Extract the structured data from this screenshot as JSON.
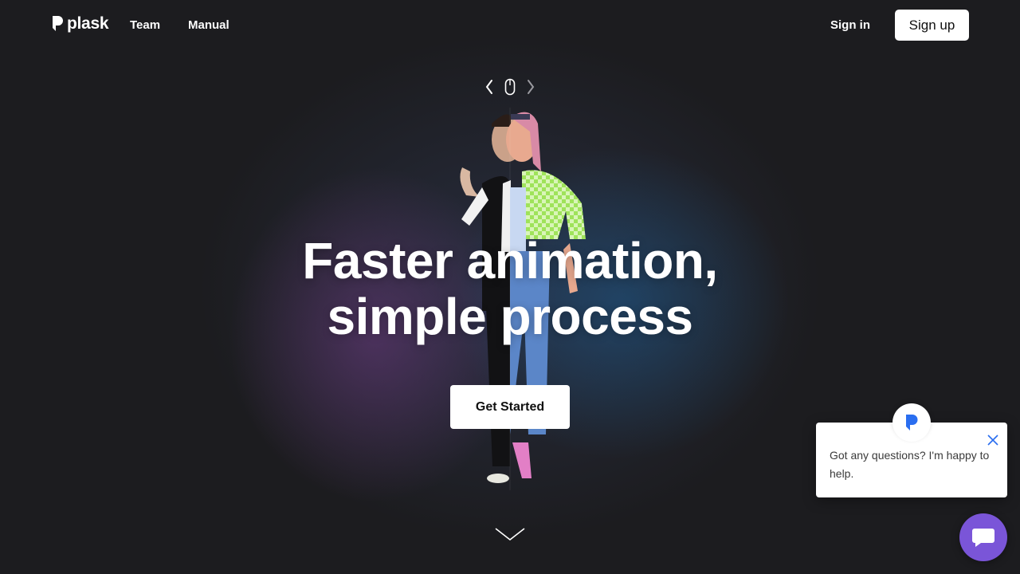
{
  "nav": {
    "logo_text": "plask",
    "links": [
      "Team",
      "Manual"
    ],
    "signin_label": "Sign in",
    "signup_label": "Sign up"
  },
  "hero": {
    "headline_line1": "Faster animation,",
    "headline_line2": "simple process",
    "cta_label": "Get Started"
  },
  "chat": {
    "message": "Got any questions? I'm happy to help."
  },
  "colors": {
    "background": "#1c1c1f",
    "button_bg": "#ffffff",
    "chat_launcher": "#7a55d8",
    "chat_brand_icon": "#2a6ef0"
  },
  "icons": [
    "logo-icon",
    "chevron-left-icon",
    "mouse-icon",
    "chevron-right-icon",
    "chevron-down-icon",
    "close-icon",
    "chat-icon"
  ]
}
